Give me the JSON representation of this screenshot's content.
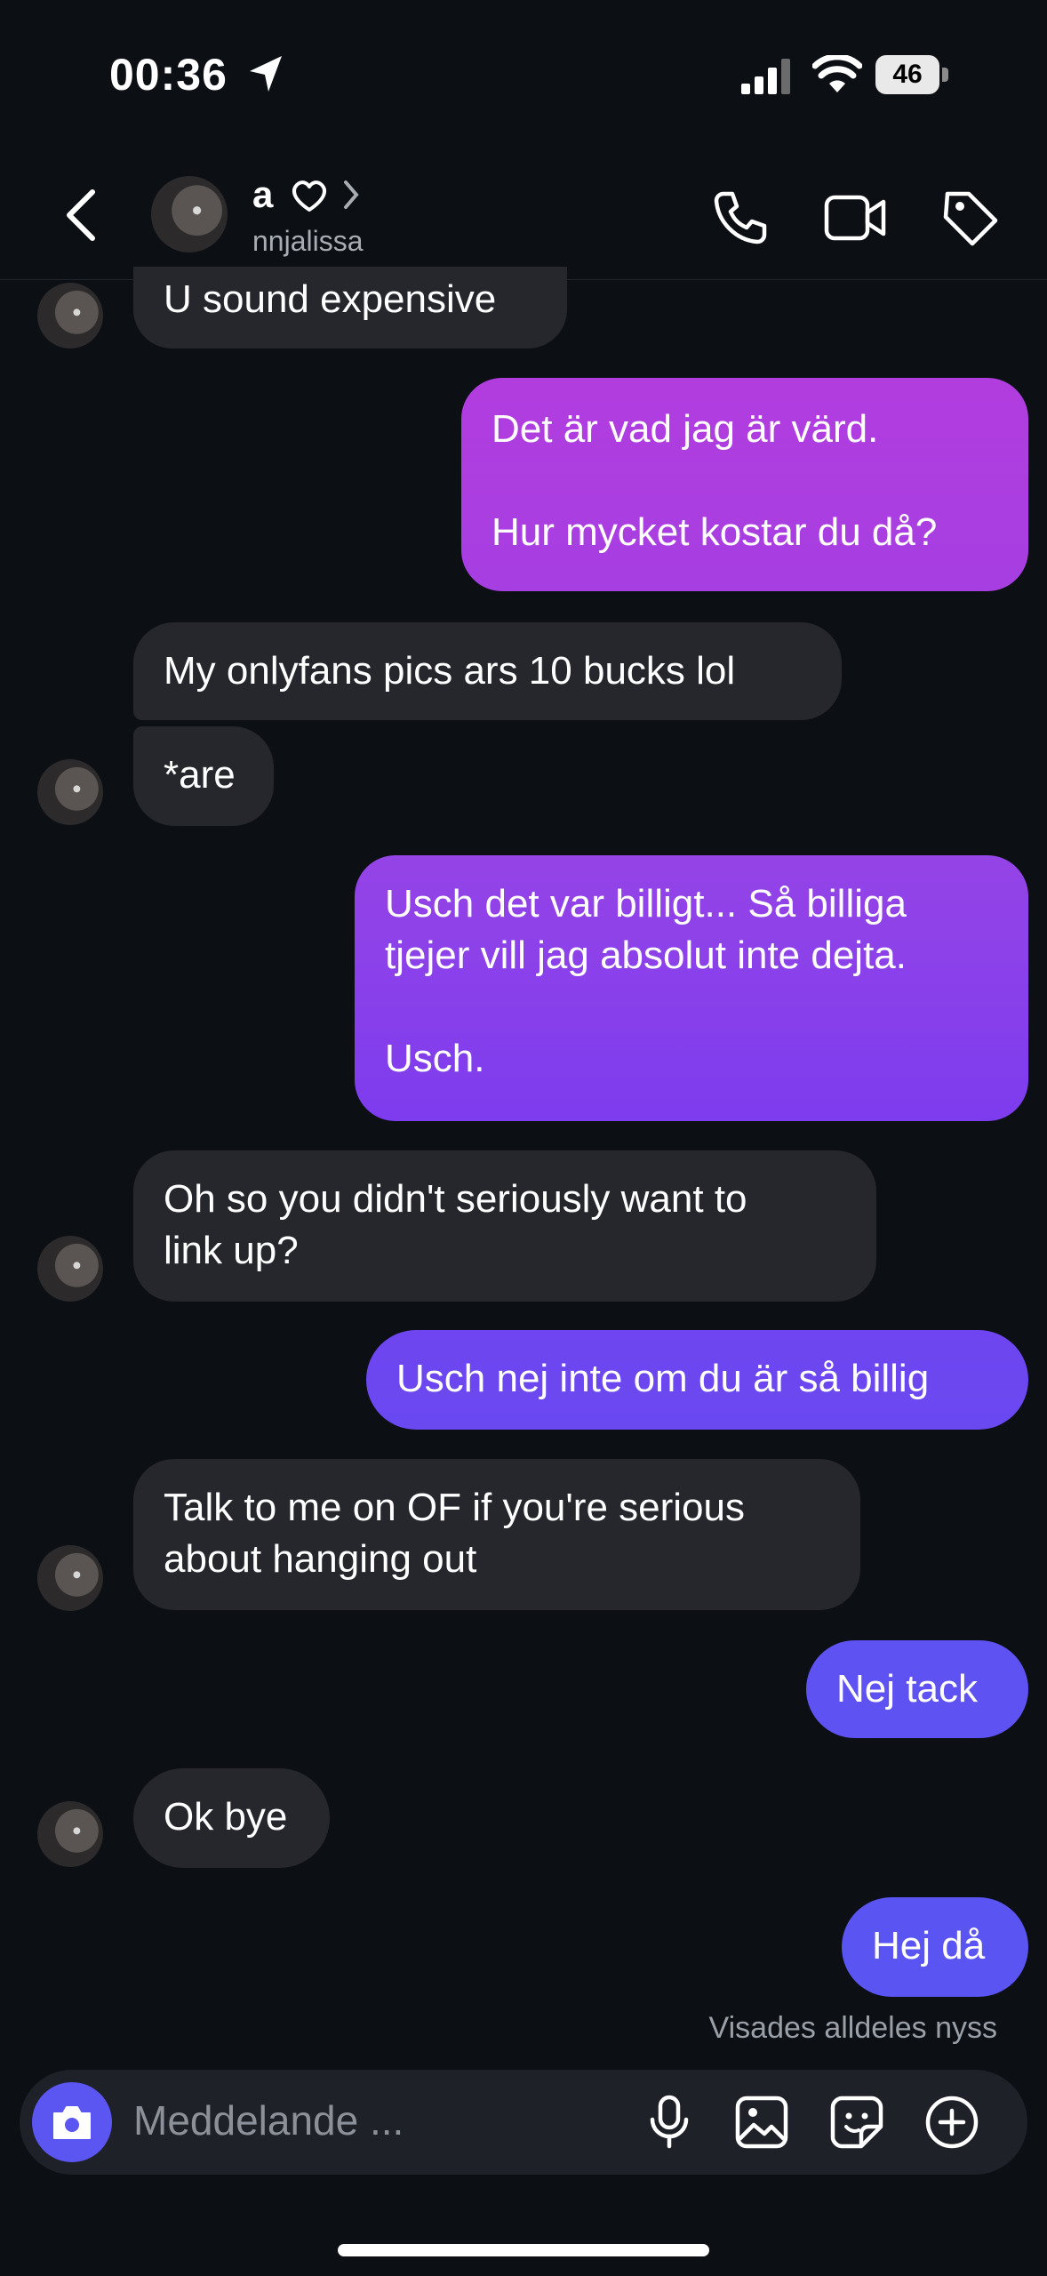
{
  "status_bar": {
    "time": "00:36",
    "battery": "46"
  },
  "header": {
    "name": "a",
    "username": "nnjalissa"
  },
  "messages": [
    {
      "side": "in",
      "text": "U sound expensive"
    },
    {
      "side": "out",
      "text": "Det är vad jag är värd.\n\nHur mycket kostar du då?"
    },
    {
      "side": "in",
      "text": "My onlyfans pics ars 10 bucks lol"
    },
    {
      "side": "in",
      "text": "*are"
    },
    {
      "side": "out",
      "text": "Usch det var billigt... Så billiga\ntjejer vill jag absolut inte dejta.\n\nUsch."
    },
    {
      "side": "in",
      "text": "Oh so you didn't seriously want to\nlink up?"
    },
    {
      "side": "out",
      "text": "Usch nej inte om du är så billig"
    },
    {
      "side": "in",
      "text": "Talk to me on OF if you're serious\nabout hanging out"
    },
    {
      "side": "out",
      "text": "Nej tack"
    },
    {
      "side": "in",
      "text": "Ok bye"
    },
    {
      "side": "out",
      "text": "Hej då"
    }
  ],
  "seen_status": "Visades alldeles nyss",
  "composer": {
    "placeholder": "Meddelande ..."
  },
  "colors": {
    "background": "#0c0f14",
    "incoming_bubble": "#25272d",
    "outgoing_top": "#b03be0",
    "outgoing_bottom": "#5b55f1"
  }
}
